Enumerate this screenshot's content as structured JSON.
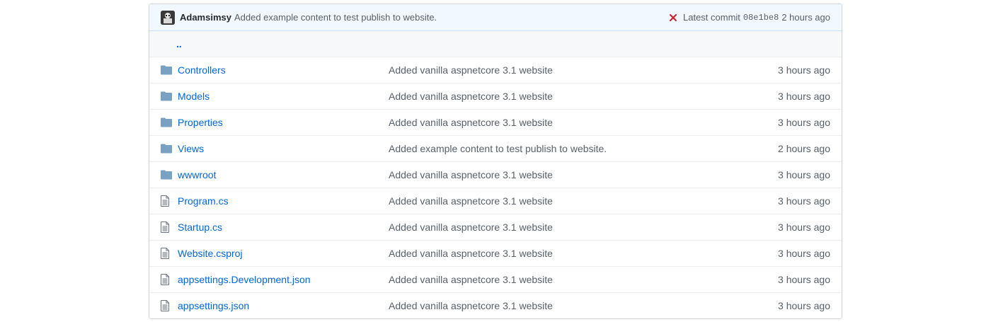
{
  "latest_commit": {
    "author": "Adamsimsy",
    "message": "Added example content to test publish to website.",
    "status_icon": "x-icon",
    "status_color": "#cb2431",
    "label": "Latest commit",
    "sha": "08e1be8",
    "age": "2 hours ago"
  },
  "parent_dir": "..",
  "files": [
    {
      "type": "dir",
      "icon": "folder-icon",
      "name": "Controllers",
      "message": "Added vanilla aspnetcore 3.1 website",
      "age": "3 hours ago"
    },
    {
      "type": "dir",
      "icon": "folder-icon",
      "name": "Models",
      "message": "Added vanilla aspnetcore 3.1 website",
      "age": "3 hours ago"
    },
    {
      "type": "dir",
      "icon": "folder-icon",
      "name": "Properties",
      "message": "Added vanilla aspnetcore 3.1 website",
      "age": "3 hours ago"
    },
    {
      "type": "dir",
      "icon": "folder-icon",
      "name": "Views",
      "message": "Added example content to test publish to website.",
      "age": "2 hours ago"
    },
    {
      "type": "dir",
      "icon": "folder-icon",
      "name": "wwwroot",
      "message": "Added vanilla aspnetcore 3.1 website",
      "age": "3 hours ago"
    },
    {
      "type": "file",
      "icon": "file-icon",
      "name": "Program.cs",
      "message": "Added vanilla aspnetcore 3.1 website",
      "age": "3 hours ago"
    },
    {
      "type": "file",
      "icon": "file-icon",
      "name": "Startup.cs",
      "message": "Added vanilla aspnetcore 3.1 website",
      "age": "3 hours ago"
    },
    {
      "type": "file",
      "icon": "file-icon",
      "name": "Website.csproj",
      "message": "Added vanilla aspnetcore 3.1 website",
      "age": "3 hours ago"
    },
    {
      "type": "file",
      "icon": "file-icon",
      "name": "appsettings.Development.json",
      "message": "Added vanilla aspnetcore 3.1 website",
      "age": "3 hours ago"
    },
    {
      "type": "file",
      "icon": "file-icon",
      "name": "appsettings.json",
      "message": "Added vanilla aspnetcore 3.1 website",
      "age": "3 hours ago"
    }
  ],
  "colors": {
    "link": "#0366d6",
    "icon": "#6a8ea8",
    "muted": "#586069",
    "commit_bar_bg": "#f1f8ff"
  }
}
